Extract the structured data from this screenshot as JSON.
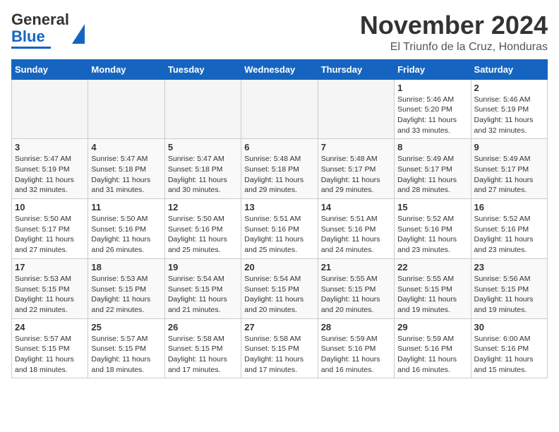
{
  "header": {
    "logo_general": "General",
    "logo_blue": "Blue",
    "month": "November 2024",
    "location": "El Triunfo de la Cruz, Honduras"
  },
  "weekdays": [
    "Sunday",
    "Monday",
    "Tuesday",
    "Wednesday",
    "Thursday",
    "Friday",
    "Saturday"
  ],
  "weeks": [
    [
      {
        "day": "",
        "info": ""
      },
      {
        "day": "",
        "info": ""
      },
      {
        "day": "",
        "info": ""
      },
      {
        "day": "",
        "info": ""
      },
      {
        "day": "",
        "info": ""
      },
      {
        "day": "1",
        "info": "Sunrise: 5:46 AM\nSunset: 5:20 PM\nDaylight: 11 hours\nand 33 minutes."
      },
      {
        "day": "2",
        "info": "Sunrise: 5:46 AM\nSunset: 5:19 PM\nDaylight: 11 hours\nand 32 minutes."
      }
    ],
    [
      {
        "day": "3",
        "info": "Sunrise: 5:47 AM\nSunset: 5:19 PM\nDaylight: 11 hours\nand 32 minutes."
      },
      {
        "day": "4",
        "info": "Sunrise: 5:47 AM\nSunset: 5:18 PM\nDaylight: 11 hours\nand 31 minutes."
      },
      {
        "day": "5",
        "info": "Sunrise: 5:47 AM\nSunset: 5:18 PM\nDaylight: 11 hours\nand 30 minutes."
      },
      {
        "day": "6",
        "info": "Sunrise: 5:48 AM\nSunset: 5:18 PM\nDaylight: 11 hours\nand 29 minutes."
      },
      {
        "day": "7",
        "info": "Sunrise: 5:48 AM\nSunset: 5:17 PM\nDaylight: 11 hours\nand 29 minutes."
      },
      {
        "day": "8",
        "info": "Sunrise: 5:49 AM\nSunset: 5:17 PM\nDaylight: 11 hours\nand 28 minutes."
      },
      {
        "day": "9",
        "info": "Sunrise: 5:49 AM\nSunset: 5:17 PM\nDaylight: 11 hours\nand 27 minutes."
      }
    ],
    [
      {
        "day": "10",
        "info": "Sunrise: 5:50 AM\nSunset: 5:17 PM\nDaylight: 11 hours\nand 27 minutes."
      },
      {
        "day": "11",
        "info": "Sunrise: 5:50 AM\nSunset: 5:16 PM\nDaylight: 11 hours\nand 26 minutes."
      },
      {
        "day": "12",
        "info": "Sunrise: 5:50 AM\nSunset: 5:16 PM\nDaylight: 11 hours\nand 25 minutes."
      },
      {
        "day": "13",
        "info": "Sunrise: 5:51 AM\nSunset: 5:16 PM\nDaylight: 11 hours\nand 25 minutes."
      },
      {
        "day": "14",
        "info": "Sunrise: 5:51 AM\nSunset: 5:16 PM\nDaylight: 11 hours\nand 24 minutes."
      },
      {
        "day": "15",
        "info": "Sunrise: 5:52 AM\nSunset: 5:16 PM\nDaylight: 11 hours\nand 23 minutes."
      },
      {
        "day": "16",
        "info": "Sunrise: 5:52 AM\nSunset: 5:16 PM\nDaylight: 11 hours\nand 23 minutes."
      }
    ],
    [
      {
        "day": "17",
        "info": "Sunrise: 5:53 AM\nSunset: 5:15 PM\nDaylight: 11 hours\nand 22 minutes."
      },
      {
        "day": "18",
        "info": "Sunrise: 5:53 AM\nSunset: 5:15 PM\nDaylight: 11 hours\nand 22 minutes."
      },
      {
        "day": "19",
        "info": "Sunrise: 5:54 AM\nSunset: 5:15 PM\nDaylight: 11 hours\nand 21 minutes."
      },
      {
        "day": "20",
        "info": "Sunrise: 5:54 AM\nSunset: 5:15 PM\nDaylight: 11 hours\nand 20 minutes."
      },
      {
        "day": "21",
        "info": "Sunrise: 5:55 AM\nSunset: 5:15 PM\nDaylight: 11 hours\nand 20 minutes."
      },
      {
        "day": "22",
        "info": "Sunrise: 5:55 AM\nSunset: 5:15 PM\nDaylight: 11 hours\nand 19 minutes."
      },
      {
        "day": "23",
        "info": "Sunrise: 5:56 AM\nSunset: 5:15 PM\nDaylight: 11 hours\nand 19 minutes."
      }
    ],
    [
      {
        "day": "24",
        "info": "Sunrise: 5:57 AM\nSunset: 5:15 PM\nDaylight: 11 hours\nand 18 minutes."
      },
      {
        "day": "25",
        "info": "Sunrise: 5:57 AM\nSunset: 5:15 PM\nDaylight: 11 hours\nand 18 minutes."
      },
      {
        "day": "26",
        "info": "Sunrise: 5:58 AM\nSunset: 5:15 PM\nDaylight: 11 hours\nand 17 minutes."
      },
      {
        "day": "27",
        "info": "Sunrise: 5:58 AM\nSunset: 5:15 PM\nDaylight: 11 hours\nand 17 minutes."
      },
      {
        "day": "28",
        "info": "Sunrise: 5:59 AM\nSunset: 5:16 PM\nDaylight: 11 hours\nand 16 minutes."
      },
      {
        "day": "29",
        "info": "Sunrise: 5:59 AM\nSunset: 5:16 PM\nDaylight: 11 hours\nand 16 minutes."
      },
      {
        "day": "30",
        "info": "Sunrise: 6:00 AM\nSunset: 5:16 PM\nDaylight: 11 hours\nand 15 minutes."
      }
    ]
  ]
}
